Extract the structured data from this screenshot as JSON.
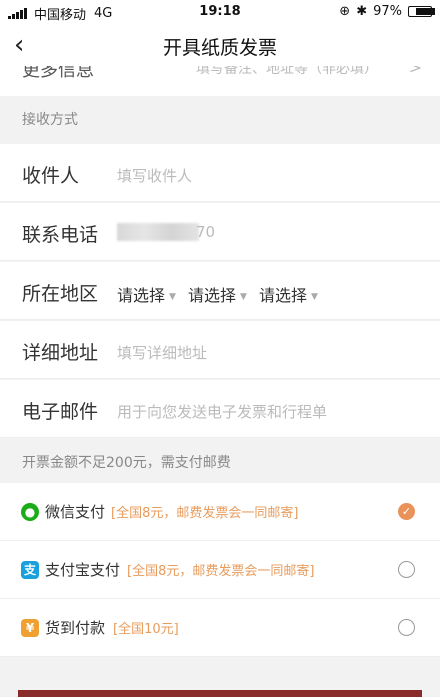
{
  "status_bar": {
    "carrier": "中国移动",
    "network": "4G",
    "time": "19:18",
    "battery": "97%",
    "battery_level": 0.97,
    "lock_icon": "orientation-lock-icon",
    "bluetooth_icon": "bluetooth-icon"
  },
  "nav": {
    "back_icon": "‹",
    "title": "开具纸质发票"
  },
  "more_info": {
    "label": "更多信息",
    "hint": "填写备注、地址等（非必填）",
    "arrow": ">"
  },
  "receive_section": {
    "header": "接收方式",
    "recipient": {
      "label": "收件人",
      "placeholder": "填写收件人"
    },
    "phone": {
      "label": "联系电话",
      "suffix": "70"
    },
    "region": {
      "label": "所在地区",
      "options": [
        "请选择",
        "请选择",
        "请选择"
      ]
    },
    "address": {
      "label": "详细地址",
      "placeholder": "填写详细地址"
    },
    "email": {
      "label": "电子邮件",
      "placeholder": "用于向您发送电子发票和行程单"
    }
  },
  "payment_section": {
    "header": "开票金额不足200元，需支付邮费",
    "options": [
      {
        "name": "微信支付",
        "note": "[全国8元，邮费发票会一同邮寄]",
        "icon": "wechat-pay-icon",
        "color": "#1aad19",
        "checked": true
      },
      {
        "name": "支付宝支付",
        "note": "[全国8元，邮费发票会一同邮寄]",
        "icon": "alipay-icon",
        "glyph": "支",
        "color": "#1aa0dc",
        "checked": false
      },
      {
        "name": "货到付款",
        "note": "[全国10元]",
        "icon": "cash-on-delivery-icon",
        "glyph": "¥",
        "color": "#f0a030",
        "checked": false
      }
    ],
    "check_glyph": "✓"
  }
}
